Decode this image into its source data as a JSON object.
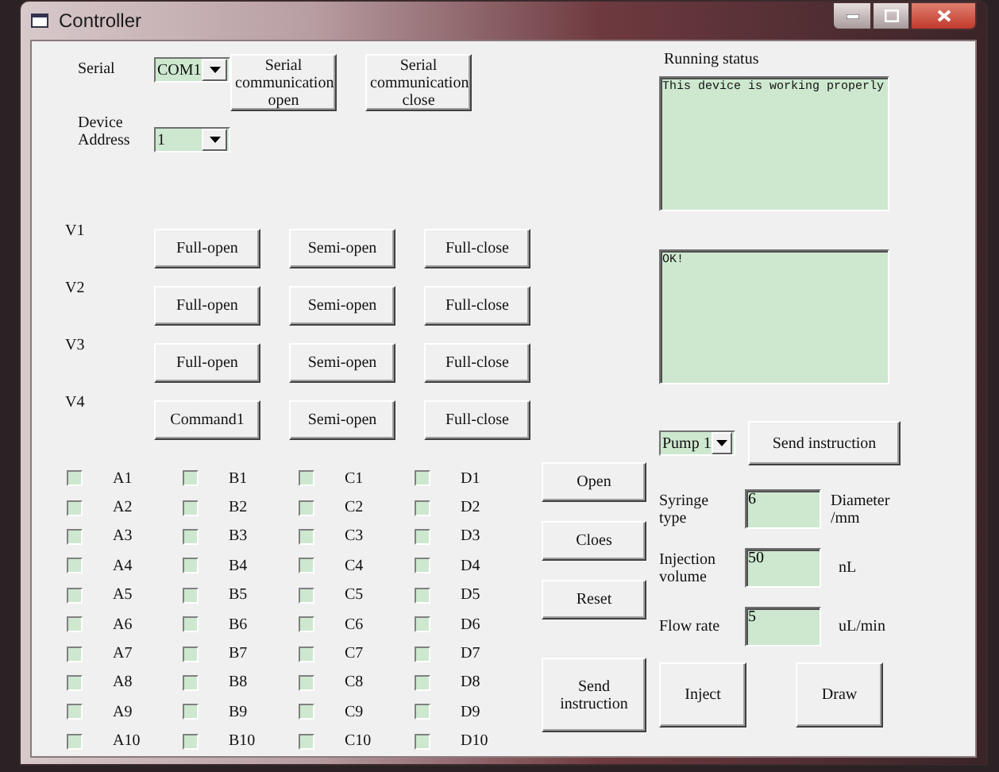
{
  "window": {
    "title": "Controller"
  },
  "serial": {
    "label": "Serial",
    "value": "COM1"
  },
  "device_address": {
    "label": "Device Address",
    "value": "1"
  },
  "serial_buttons": [
    "Serial communication open",
    "Serial communication close"
  ],
  "valves": [
    {
      "label": "V1",
      "buttons": [
        "Full-open",
        "Semi-open",
        "Full-close"
      ]
    },
    {
      "label": "V2",
      "buttons": [
        "Full-open",
        "Semi-open",
        "Full-close"
      ]
    },
    {
      "label": "V3",
      "buttons": [
        "Full-open",
        "Semi-open",
        "Full-close"
      ]
    },
    {
      "label": "V4",
      "buttons": [
        "Command1",
        "Semi-open",
        "Full-close"
      ]
    }
  ],
  "running_status": {
    "label": "Running status",
    "text": "This device is working properly"
  },
  "log": {
    "text": "OK!"
  },
  "checkbox_rows": [
    [
      {
        "label": "A1",
        "checked": false
      },
      {
        "label": "B1",
        "checked": false
      },
      {
        "label": "C1",
        "checked": false
      },
      {
        "label": "D1",
        "checked": false
      }
    ],
    [
      {
        "label": "A2",
        "checked": false
      },
      {
        "label": "B2",
        "checked": false
      },
      {
        "label": "C2",
        "checked": false
      },
      {
        "label": "D2",
        "checked": false
      }
    ],
    [
      {
        "label": "A3",
        "checked": false
      },
      {
        "label": "B3",
        "checked": false
      },
      {
        "label": "C3",
        "checked": false
      },
      {
        "label": "D3",
        "checked": false
      }
    ],
    [
      {
        "label": "A4",
        "checked": false
      },
      {
        "label": "B4",
        "checked": false
      },
      {
        "label": "C4",
        "checked": false
      },
      {
        "label": "D4",
        "checked": false
      }
    ],
    [
      {
        "label": "A5",
        "checked": false
      },
      {
        "label": "B5",
        "checked": false
      },
      {
        "label": "C5",
        "checked": false
      },
      {
        "label": "D5",
        "checked": false
      }
    ],
    [
      {
        "label": "A6",
        "checked": false
      },
      {
        "label": "B6",
        "checked": false
      },
      {
        "label": "C6",
        "checked": false
      },
      {
        "label": "D6",
        "checked": false
      }
    ],
    [
      {
        "label": "A7",
        "checked": false
      },
      {
        "label": "B7",
        "checked": false
      },
      {
        "label": "C7",
        "checked": false
      },
      {
        "label": "D7",
        "checked": false
      }
    ],
    [
      {
        "label": "A8",
        "checked": false
      },
      {
        "label": "B8",
        "checked": false
      },
      {
        "label": "C8",
        "checked": false
      },
      {
        "label": "D8",
        "checked": false
      }
    ],
    [
      {
        "label": "A9",
        "checked": false
      },
      {
        "label": "B9",
        "checked": false
      },
      {
        "label": "C9",
        "checked": false
      },
      {
        "label": "D9",
        "checked": false
      }
    ],
    [
      {
        "label": "A10",
        "checked": false
      },
      {
        "label": "B10",
        "checked": false
      },
      {
        "label": "C10",
        "checked": false
      },
      {
        "label": "D10",
        "checked": false
      }
    ]
  ],
  "middle_buttons": [
    "Open",
    "Cloes",
    "Reset",
    "Send instruction"
  ],
  "pump": {
    "value": "Pump 1",
    "send_button": "Send instruction",
    "fields": [
      {
        "label": "Syringe type",
        "value": "6",
        "unit": "Diameter /mm"
      },
      {
        "label": "Injection volume",
        "value": "50",
        "unit": "nL"
      },
      {
        "label": "Flow rate",
        "value": "5",
        "unit": "uL/min"
      }
    ],
    "buttons": [
      "Inject",
      "Draw"
    ]
  }
}
